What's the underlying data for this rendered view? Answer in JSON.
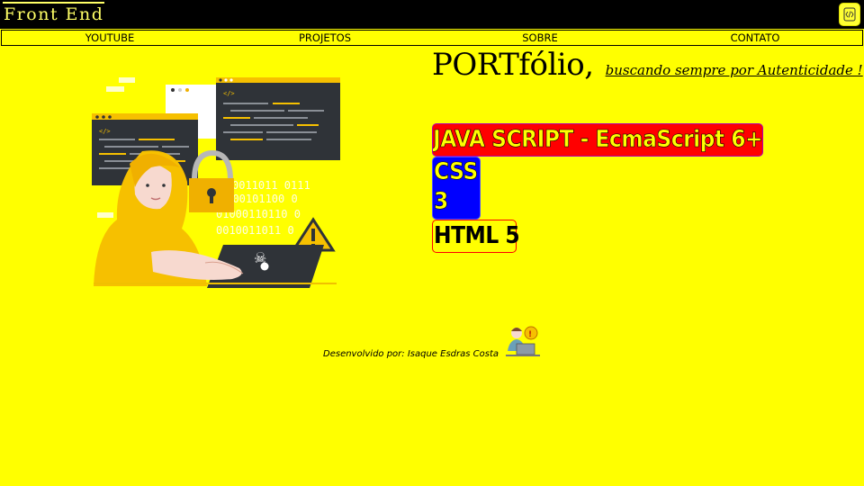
{
  "header": {
    "brand": "Front End",
    "code_icon": "code-icon"
  },
  "nav": {
    "items": [
      {
        "label": "YOUTUBE"
      },
      {
        "label": "PROJETOS"
      },
      {
        "label": "SOBRE"
      },
      {
        "label": "CONTATO"
      }
    ]
  },
  "hero": {
    "title": "PORTfólio,",
    "subtitle": "buscando sempre por Autenticidade !",
    "illustration": "hacker-laptop-illustration",
    "binary_lines": [
      "00110110 0111",
      "1000101100 0",
      "01000110110 0",
      "0010011011 0"
    ]
  },
  "skills": {
    "js": "JAVA SCRIPT - EcmaScript 6+",
    "css_line1": "CSS",
    "css_line2": "3",
    "html": "HTML 5"
  },
  "footer": {
    "text": "Desenvolvido por: Isaque Esdras Costa",
    "icon": "developer-at-laptop-icon"
  },
  "colors": {
    "background": "#ffff00",
    "topbar": "#000000",
    "js_badge": "#ff0000",
    "css_badge": "#0000ff",
    "html_border": "#ff0000"
  }
}
